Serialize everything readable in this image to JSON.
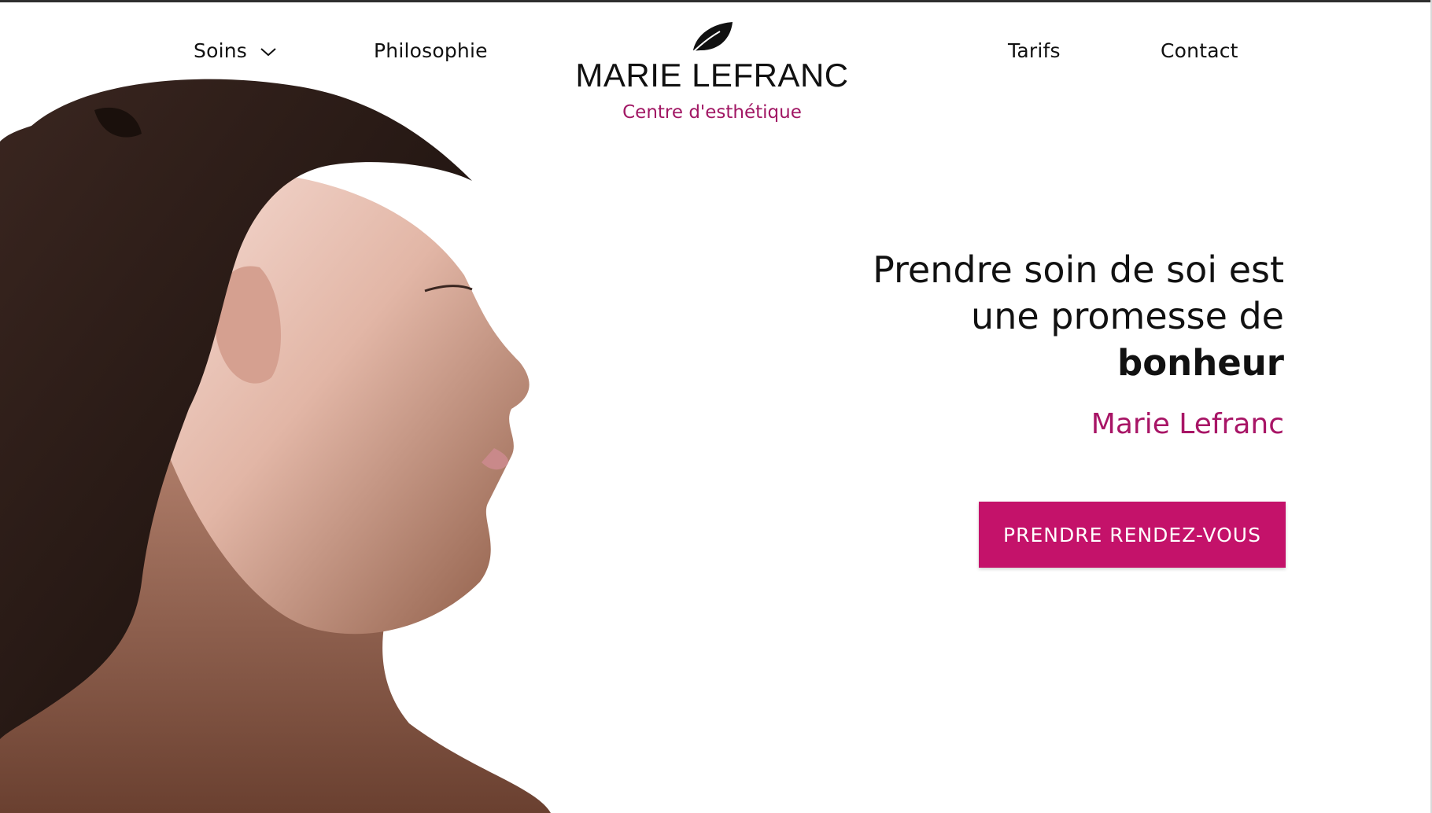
{
  "nav": {
    "soins_label": "Soins",
    "soins_icon": "chevron-down-icon",
    "philosophie_label": "Philosophie",
    "tarifs_label": "Tarifs",
    "contact_label": "Contact"
  },
  "logo": {
    "icon": "leaf-icon",
    "name": "MARIE LEFRANC",
    "subtitle": "Centre d'esthétique"
  },
  "hero": {
    "line1": "Prendre soin de soi est",
    "line2": "une promesse de",
    "line3": "bonheur",
    "author": "Marie Lefranc",
    "cta_label": "PRENDRE RENDEZ-VOUS",
    "image": "woman-profile-photo"
  },
  "colors": {
    "accent": "#c4126a",
    "accent_text": "#a81566",
    "text": "#111111",
    "background": "#ffffff"
  }
}
